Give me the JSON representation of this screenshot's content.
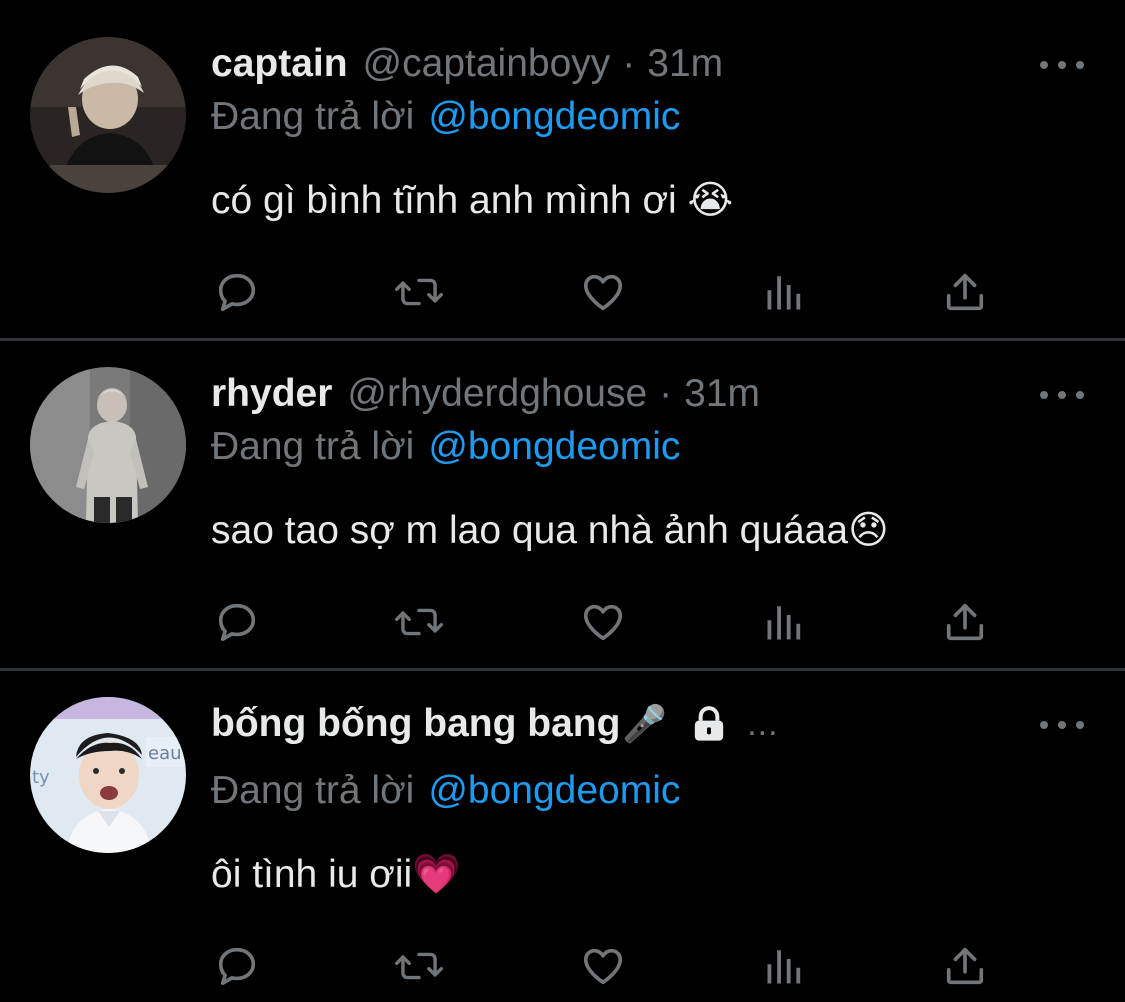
{
  "colors": {
    "background": "#000000",
    "primary_text": "#e7e9ea",
    "secondary_text": "#71767b",
    "mention": "#1d9bf0",
    "divider": "#2f3336"
  },
  "icons": [
    "reply-icon",
    "retweet-icon",
    "like-icon",
    "views-icon",
    "share-icon",
    "more-icon",
    "lock-icon"
  ],
  "tweets": [
    {
      "name": "captain",
      "handle": "@captainboyy",
      "separator": "·",
      "time": "31m",
      "reply_prefix": "Đang trả lời",
      "reply_mention": "@bongdeomic",
      "text": "có gì bình tĩnh anh mình ơi 😭"
    },
    {
      "name": "rhyder",
      "handle": "@rhyderdghouse",
      "separator": "·",
      "time": "31m",
      "reply_prefix": "Đang trả lời",
      "reply_mention": "@bongdeomic",
      "text": "sao tao sợ m lao qua nhà ảnh quáaa😞"
    },
    {
      "name": "bống bống bang bang",
      "name_emoji": "🎤",
      "protected": true,
      "truncated": "...",
      "reply_prefix": "Đang trả lời",
      "reply_mention": "@bongdeomic",
      "text": "ôi tình iu ơii💗"
    }
  ]
}
